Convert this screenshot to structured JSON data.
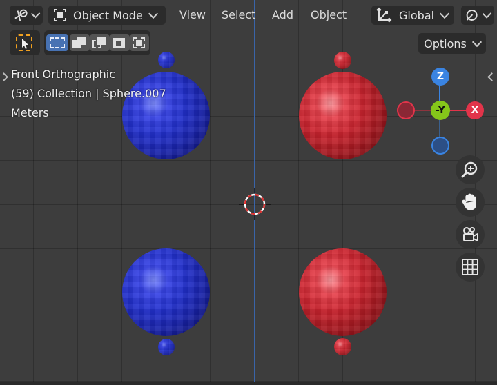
{
  "header": {
    "mode_label": "Object Mode",
    "menus": [
      "View",
      "Select",
      "Add",
      "Object"
    ],
    "transform_orientation": "Global"
  },
  "options_label": "Options",
  "viewport_info": {
    "view_name": "Front Orthographic",
    "collection_line": "(59) Collection | Sphere.007",
    "units": "Meters"
  },
  "gizmo": {
    "z_label": "Z",
    "y_label": "-Y",
    "x_label": "X",
    "colors": {
      "x": "#e2344a",
      "y": "#85c61a",
      "z": "#3a84e2"
    }
  },
  "icons": {
    "editor_type": "editor-type-icon",
    "mode": "object-mode-icon",
    "transform": "transform-orientation-icon",
    "snap": "snap-icon",
    "select_tool": "cursor-tool-icon",
    "select_modes": [
      "select-new-icon",
      "select-extend-icon",
      "select-subtract-icon",
      "select-invert-icon",
      "select-intersect-icon"
    ],
    "nav": [
      "zoom-icon",
      "pan-hand-icon",
      "camera-icon",
      "grid-icon"
    ]
  },
  "colors": {
    "blue_material": "#2230cc",
    "red_material": "#cc2530",
    "accent": "#4772b3"
  }
}
